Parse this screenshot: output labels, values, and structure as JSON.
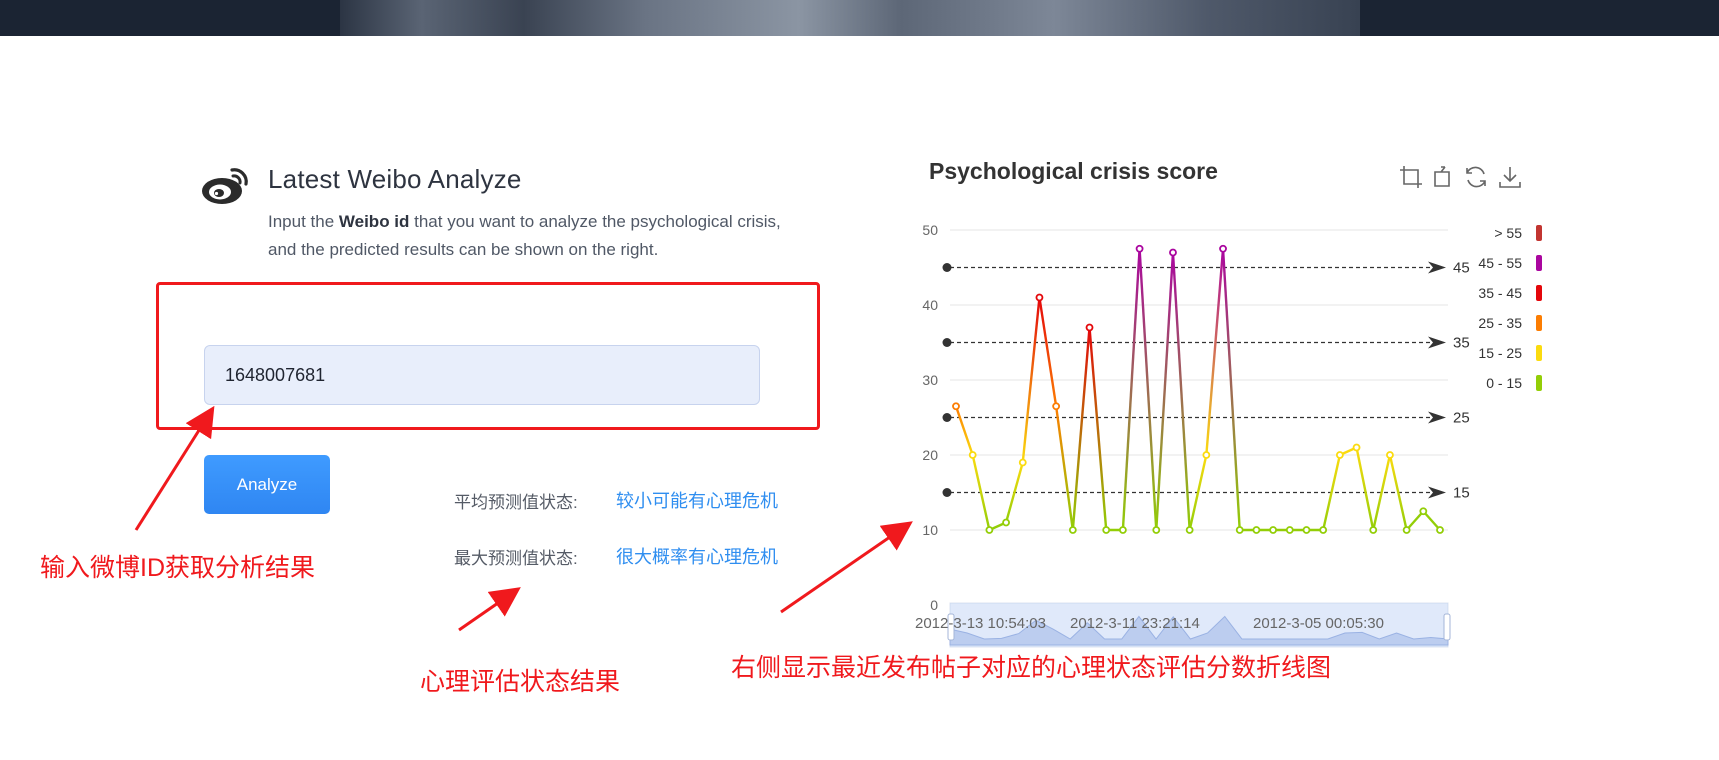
{
  "header": {
    "banner_desc": "photo banner"
  },
  "intro": {
    "title": "Latest Weibo Analyze",
    "desc_pre": "Input the ",
    "desc_bold": "Weibo id",
    "desc_post": " that you want to analyze the psychological crisis, and the predicted results can be shown on the right."
  },
  "form": {
    "id_value": "1648007681",
    "analyze_label": "Analyze"
  },
  "status": {
    "avg_label": "平均预测值状态:",
    "avg_value": "较小可能有心理危机",
    "max_label": "最大预测值状态:",
    "max_value": "很大概率有心理危机"
  },
  "annotations": {
    "input_note": "输入微博ID获取分析结果",
    "status_note": "心理评估状态结果",
    "chart_note": "右侧显示最近发布帖子对应的心理状态评估分数折线图"
  },
  "colors": {
    "accent": "#2f8ef0",
    "annotation_red": "#f0191d",
    "level_gt55": "#c23531",
    "level_45_55": "#aa069f",
    "level_35_45": "#e4070b",
    "level_25_35": "#fc7d02",
    "level_15_25": "#fbdb0f",
    "level_0_15": "#93ce07"
  },
  "toolbar": {
    "icons": [
      "zoom-icon",
      "zoom-reset-icon",
      "restore-icon",
      "download-icon"
    ]
  },
  "chart_data": {
    "type": "line",
    "title": "Psychological crisis score",
    "ylim": [
      0,
      50
    ],
    "yticks": [
      "0",
      "10",
      "20",
      "30",
      "40",
      "50"
    ],
    "x_labels_visible": [
      "2012-3-13 10:54:03",
      "2012-3-11 23:21:14",
      "2012-3-05 00:05:30"
    ],
    "series": [
      {
        "values": [
          26.5,
          20,
          10,
          11,
          19,
          41,
          26.5,
          10,
          37,
          10,
          10,
          47.5,
          10,
          47,
          10,
          20,
          47.5,
          10,
          10,
          10,
          10,
          10,
          10,
          20,
          21,
          10,
          20,
          10,
          12.5,
          10
        ]
      }
    ],
    "mark_lines": [
      45,
      35,
      25,
      15
    ],
    "visual_map": [
      {
        "label": "> 55",
        "color": "#c23531"
      },
      {
        "label": "45 - 55",
        "color": "#aa069f"
      },
      {
        "label": "35 - 45",
        "color": "#e4070b"
      },
      {
        "label": "25 - 35",
        "color": "#fc7d02"
      },
      {
        "label": "15 - 25",
        "color": "#fbdb0f"
      },
      {
        "label": "0 - 15",
        "color": "#93ce07"
      }
    ],
    "grid": true,
    "legend_position": "right",
    "datazoom_slider": true
  }
}
